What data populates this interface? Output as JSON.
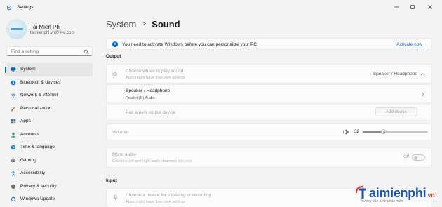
{
  "window": {
    "title": "Settings"
  },
  "profile": {
    "name": "Tai Mien Phi",
    "email": "taimienphi.vn@live.com"
  },
  "search": {
    "placeholder": "Find a setting"
  },
  "nav": {
    "items": [
      {
        "label": "System",
        "icon": "monitor-icon",
        "color": "#0067c0",
        "active": true
      },
      {
        "label": "Bluetooth & devices",
        "icon": "bluetooth-icon",
        "color": "#0078d4"
      },
      {
        "label": "Network & internet",
        "icon": "wifi-icon",
        "color": "#2a7ac5"
      },
      {
        "label": "Personalization",
        "icon": "brush-icon",
        "color": "#d98a3a"
      },
      {
        "label": "Apps",
        "icon": "apps-icon",
        "color": "#4c6a87"
      },
      {
        "label": "Accounts",
        "icon": "person-icon",
        "color": "#2aa35e"
      },
      {
        "label": "Time & language",
        "icon": "globe-clock-icon",
        "color": "#1a7fc4"
      },
      {
        "label": "Gaming",
        "icon": "gamepad-icon",
        "color": "#6b6b6b"
      },
      {
        "label": "Accessibility",
        "icon": "accessibility-icon",
        "color": "#1a73c9"
      },
      {
        "label": "Privacy & security",
        "icon": "shield-icon",
        "color": "#6d6d6d"
      },
      {
        "label": "Windows Update",
        "icon": "update-icon",
        "color": "#1a73c9"
      }
    ]
  },
  "breadcrumb": {
    "parent": "System",
    "separator": ">",
    "current": "Sound"
  },
  "banner": {
    "text": "You need to activate Windows before you can personalize your PC.",
    "link": "Activate now"
  },
  "output": {
    "heading": "Output",
    "choose_title": "Choose where to play sound",
    "choose_sub": "Apps might have their own settings",
    "choose_value": "Speaker / Headphone",
    "device_title": "Speaker / Headphone",
    "device_sub": "Realtek(R) Audio",
    "pair_title": "Pair a new output device",
    "add_device": "Add device",
    "volume_label": "Volume",
    "volume_value": "32",
    "volume_level": 0.32,
    "mono_title": "Mono audio",
    "mono_sub": "Combine left and right audio channels into one",
    "mono_state": "Off"
  },
  "input": {
    "heading": "Input",
    "choose_title": "Choose a device for speaking or recording",
    "choose_sub": "Apps might have their own settings"
  },
  "watermark": {
    "brand": "aimienphi",
    "tld": ".vn",
    "sub": "Hướng dẫn & tải phần mềm"
  }
}
